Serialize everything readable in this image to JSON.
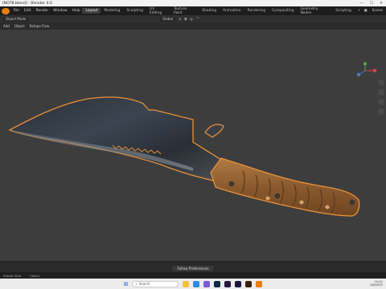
{
  "window": {
    "title": "[NOT8.blend] - Blender 4.0"
  },
  "menubar": {
    "menus": [
      "File",
      "Edit",
      "Render",
      "Window",
      "Help"
    ],
    "workspaces": [
      "Layout",
      "Modeling",
      "Sculpting",
      "UV Editing",
      "Texture Paint",
      "Shading",
      "Animation",
      "Rendering",
      "Compositing",
      "Geometry Nodes",
      "Scripting"
    ],
    "active_workspace": "Layout",
    "scene_label": "Scene"
  },
  "toolbar": {
    "mode": "Object Mode",
    "orientation": "Global"
  },
  "header2": {
    "items": [
      "Add",
      "Object",
      "Retopo Flow"
    ]
  },
  "timeline": {
    "notification": "Follow Preferences"
  },
  "statusbar": {
    "left": "Rotate View",
    "right": "Object"
  },
  "taskbar": {
    "search_placeholder": "Search",
    "time": "10:41",
    "date": "1/8/2025"
  },
  "colors": {
    "selection_outline": "#e8913a",
    "blender_orange": "#e87d0d"
  }
}
